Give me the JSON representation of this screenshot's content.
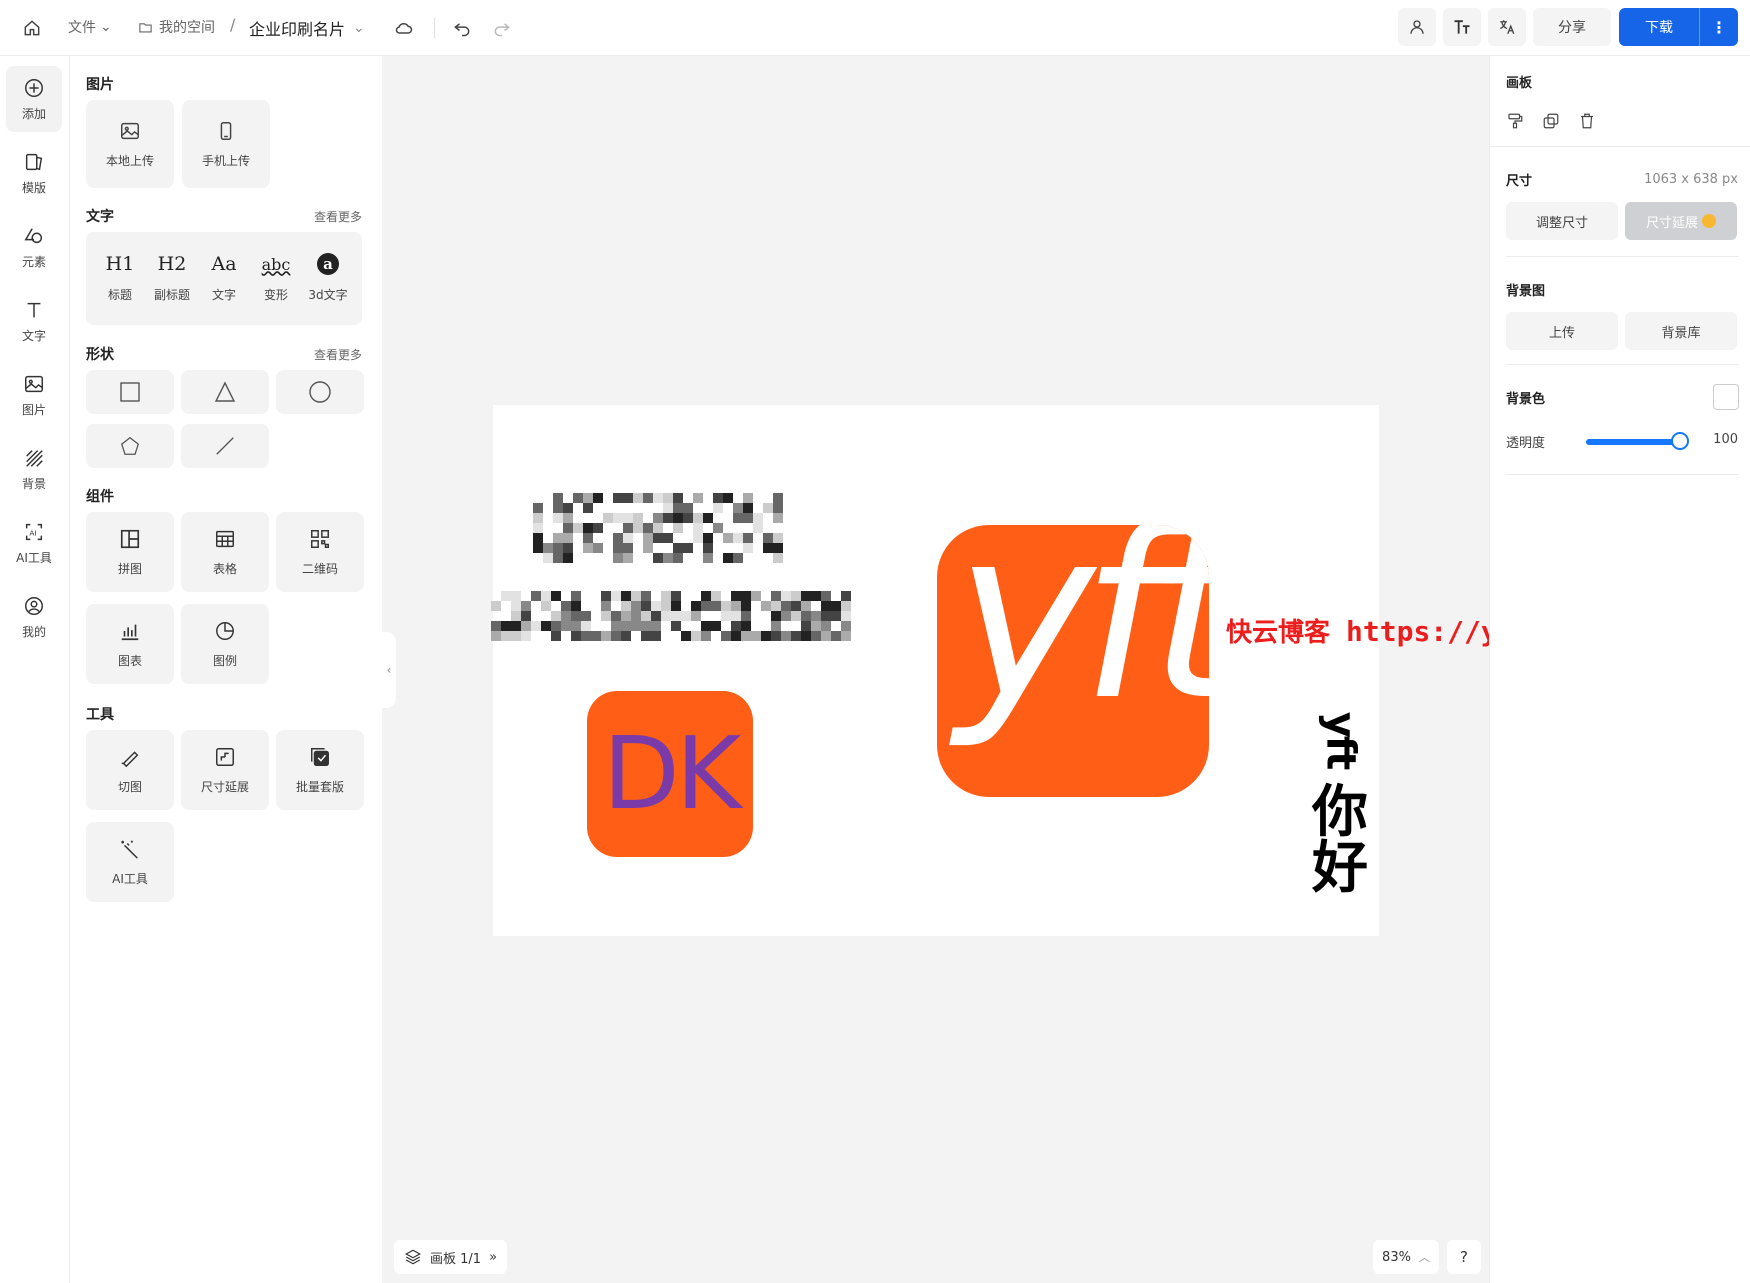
{
  "colors": {
    "accent": "#1665e8",
    "brand_orange": "#ff5e16",
    "dk_purple": "#7a3aa8",
    "watermark_red": "#ec1d1d"
  },
  "topbar": {
    "home_icon": "home-icon",
    "file_menu": "文件",
    "space_label": "我的空间",
    "separator": "/",
    "doc_title": "企业印刷名片",
    "share_label": "分享",
    "download_label": "下载",
    "more_label": "⋮"
  },
  "leftnav": {
    "items": [
      {
        "label": "添加",
        "icon": "plus-circle-icon"
      },
      {
        "label": "模版",
        "icon": "template-icon"
      },
      {
        "label": "元素",
        "icon": "shapes-icon"
      },
      {
        "label": "文字",
        "icon": "text-icon"
      },
      {
        "label": "图片",
        "icon": "image-icon"
      },
      {
        "label": "背景",
        "icon": "background-icon"
      },
      {
        "label": "AI工具",
        "icon": "ai-icon"
      },
      {
        "label": "我的",
        "icon": "user-circle-icon"
      }
    ]
  },
  "panel": {
    "images": {
      "title": "图片",
      "items": [
        {
          "label": "本地上传",
          "icon": "image-icon"
        },
        {
          "label": "手机上传",
          "icon": "phone-icon"
        }
      ]
    },
    "text": {
      "title": "文字",
      "more": "查看更多",
      "items": [
        {
          "glyph": "H1",
          "label": "标题"
        },
        {
          "glyph": "H2",
          "label": "副标题"
        },
        {
          "glyph": "Aa",
          "label": "文字"
        },
        {
          "glyph": "abc",
          "label": "变形"
        },
        {
          "glyph": "a",
          "label": "3d文字"
        }
      ]
    },
    "shapes": {
      "title": "形状",
      "more": "查看更多",
      "items": [
        "square-icon",
        "triangle-icon",
        "circle-icon",
        "pentagon-icon",
        "line-icon"
      ]
    },
    "components": {
      "title": "组件",
      "items": [
        {
          "label": "拼图",
          "icon": "collage-icon"
        },
        {
          "label": "表格",
          "icon": "table-icon"
        },
        {
          "label": "二维码",
          "icon": "qrcode-icon"
        },
        {
          "label": "图表",
          "icon": "chart-icon"
        },
        {
          "label": "图例",
          "icon": "pie-icon"
        }
      ]
    },
    "tools": {
      "title": "工具",
      "items": [
        {
          "label": "切图",
          "icon": "cut-icon"
        },
        {
          "label": "尺寸延展",
          "icon": "resize-icon"
        },
        {
          "label": "批量套版",
          "icon": "batch-icon"
        },
        {
          "label": "AI工具",
          "icon": "magic-wand-icon"
        }
      ]
    }
  },
  "canvas": {
    "dk_text": "DK",
    "yft_text": "yft",
    "vertical_latin": "yft",
    "vertical_cjk": [
      "你",
      "好"
    ],
    "watermark_cn": "快云博客",
    "watermark_url": "https://yinghuangi.cn/",
    "board_label": "画板 1/1",
    "board_arrow": "»",
    "zoom": "83%",
    "help": "?"
  },
  "rpanel": {
    "title": "画板",
    "size_label": "尺寸",
    "size_value": "1063 x 638 px",
    "resize_btn": "调整尺寸",
    "extend_btn": "尺寸延展",
    "bg_image_label": "背景图",
    "upload_btn": "上传",
    "library_btn": "背景库",
    "bg_color_label": "背景色",
    "opacity_label": "透明度",
    "opacity_value": "100",
    "opacity_fraction": 0.92
  }
}
